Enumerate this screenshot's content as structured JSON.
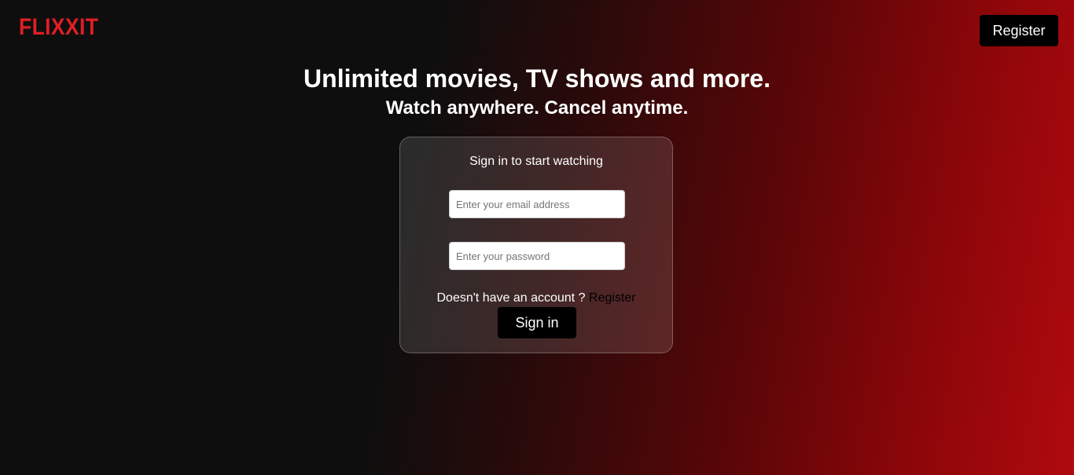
{
  "header": {
    "logo": "FLIXXIT",
    "register_label": "Register"
  },
  "hero": {
    "title": "Unlimited movies, TV shows and more.",
    "subtitle": "Watch anywhere. Cancel anytime."
  },
  "signin_card": {
    "title": "Sign in to start watching",
    "email_placeholder": "Enter your email address",
    "email_value": "",
    "password_placeholder": "Enter your password",
    "password_value": "",
    "account_prompt": "Doesn't have an account ?",
    "register_link": "Register",
    "signin_label": "Sign in"
  },
  "colors": {
    "brand": "#e01e24",
    "button_bg": "#000000",
    "background_dark": "#0e0e0e",
    "background_red": "#b00a0e"
  }
}
